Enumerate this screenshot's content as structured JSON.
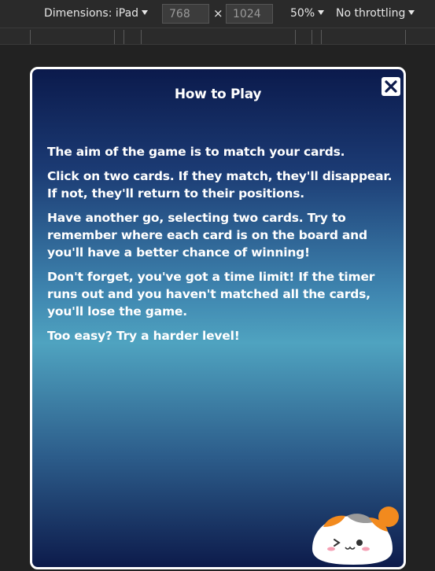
{
  "devtools": {
    "dimensions_label": "Dimensions: iPad",
    "width": "768",
    "times": "×",
    "height": "1024",
    "zoom": "50%",
    "throttling": "No throttling"
  },
  "modal": {
    "title": "How to Play",
    "paragraphs": [
      "The aim of the game is to match your cards.",
      "Click on two cards. If they match, they'll disappear. If not, they'll return to their positions.",
      "Have another go, selecting two cards. Try to remember where each card is on the board and you'll have a better chance of winning!",
      "Don't forget, you've got a time limit! If the timer runs out and you haven't matched all the cards, you'll lose the game.",
      "Too easy? Try a harder level!"
    ],
    "close_icon": "close-icon",
    "mascot_icon": "cat-mascot"
  }
}
